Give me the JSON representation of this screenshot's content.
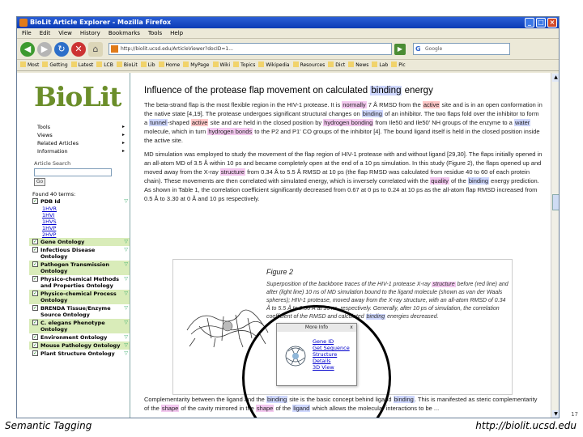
{
  "window": {
    "title": "BioLit Article Explorer - Mozilla Firefox"
  },
  "menubar": [
    "File",
    "Edit",
    "View",
    "History",
    "Bookmarks",
    "Tools",
    "Help"
  ],
  "navbar": {
    "url": "http://biolit.ucsd.edu/ArticleViewer?docID=1...",
    "search_placeholder": "Google"
  },
  "bookmarks": [
    "Most",
    "Getting",
    "Latest",
    "LCB",
    "BioLit",
    "Lib",
    "Home",
    "MyPage",
    "Wiki",
    "Topics",
    "Wikipedia",
    "Resources",
    "Dict",
    "News",
    "Lab",
    "Pic"
  ],
  "left_panel": {
    "logo": "BioLit",
    "menu": [
      {
        "label": "Tools",
        "arrow": "▸"
      },
      {
        "label": "Views",
        "arrow": "▸"
      },
      {
        "label": "Related Articles",
        "arrow": "▸"
      },
      {
        "label": "Information",
        "arrow": "▸"
      }
    ],
    "search_label": "Article Search",
    "go_label": "Go",
    "found_label": "Found 40 terms:",
    "categories": [
      {
        "name": "PDB Id",
        "links": [
          "1HVR",
          "1HVI",
          "1HVS",
          "1HVP",
          "2HVP"
        ]
      },
      {
        "name": "Gene Ontology",
        "links": []
      },
      {
        "name": "Infectious Disease Ontology",
        "links": []
      },
      {
        "name": "Pathogen Transmission Ontology",
        "links": []
      },
      {
        "name": "Physico-chemical Methods and Properties Ontology",
        "links": []
      },
      {
        "name": "Physico-chemical Process Ontology",
        "links": []
      },
      {
        "name": "BRENDA Tissue/Enzyme Source Ontology",
        "links": []
      },
      {
        "name": "C. elegans Phenotype Ontology",
        "links": []
      },
      {
        "name": "Environment Ontology",
        "links": []
      },
      {
        "name": "Mouse Pathology Ontology",
        "links": []
      },
      {
        "name": "Plant Structure Ontology",
        "links": []
      }
    ]
  },
  "main": {
    "title_pre": "Influence of the protease flap movement on calculated ",
    "title_hl": "binding",
    "title_post": " energy",
    "p1": {
      "a": "The beta-strand flap is the most flexible region in the HIV-1 protease. It is ",
      "h1": "normally",
      "b": " 7 Å RMSD from the ",
      "h2": "active",
      "c": " site and is in an open conformation in the native state [4,19]. The protease undergoes significant structural changes on ",
      "h3": "binding",
      "d": " of an inhibitor. The two flaps fold over the inhibitor to form a ",
      "h4": "tunnel",
      "e": "-shaped ",
      "h5": "active",
      "f": " site and are held in the closed position by ",
      "h6": "hydrogen bonding",
      "g": " from Ile50 and Ile50' NH groups of the enzyme to a ",
      "h7": "water",
      "h": " molecule, which in turn ",
      "h8": "hydrogen bonds",
      "i": " to the P2 and P1' CO groups of the inhibitor [4]. The bound ligand itself is held in the closed position inside the active site."
    },
    "p2": {
      "a": "MD simulation was employed to study the movement of the flap region of HIV-1 protease with and without ligand [29,30]. The flaps initially opened in an all-atom MD of 3.5 Å within 10 ps and became completely open at the end of a 10 ps simulation. In this study (Figure 2), the flaps opened up and moved away from the X-ray ",
      "h1": "structure",
      "b": " from 0.34 Å to 5.5 Å RMSD at 10 ps (the flap RMSD was calculated from residue 40 to 60 of each protein chain). These movements are then correlated with simulated energy, which is inversely correlated with the ",
      "h2": "quality",
      "c": " of the ",
      "h3": "binding",
      "d": " energy prediction. As shown in Table 1, the correlation coefficient significantly decreased from 0.67 at 0 ps to 0.24 at 10 ps as the all-atom flap RMSD increased from 0.5 Å to 3.30 at 0 Å and 10 ps respectively."
    },
    "figure": {
      "title": "Figure 2",
      "caption_a": "Superposition of the backbone traces of the HIV-1 protease X-ray ",
      "caption_h": "structure",
      "caption_b": " before (red line) and after (light line) 10 ns of MD simulation bound to the ligand molecule (shown as van der Waals spheres); HIV-1 protease, moved away from the X-ray structure, with an all-atom RMSD of 0.34 Å to 5.5 Å to 2.50 Å at 10 ns, respectively. Generally, after 10 ps of simulation, the correlation coefficient of the RMSD and calculated ",
      "caption_h2": "binding",
      "caption_c": " energies decreased."
    },
    "bottom": {
      "a": "Complementarity between the ligand and the ",
      "h1": "binding",
      "b": " site is the basic concept behind ligand ",
      "h2": "binding",
      "c": ". This is manifested as steric complementarity of the ",
      "h3": "shape",
      "d": " of the cavity mirrored in the ",
      "h4": "shape",
      "e": " of the ",
      "h5": "ligand",
      "f": " which allows the molecular interactions to be ..."
    }
  },
  "popup": {
    "title": "More Info",
    "close": "x",
    "links": [
      "Gene ID",
      "Get Sequence",
      "Structure",
      "Details",
      "3D View"
    ]
  },
  "footer": {
    "left": "Semantic Tagging",
    "right": "http://biolit.ucsd.edu",
    "slide_number": "17"
  },
  "colors": {
    "logo": "#6b8e2a",
    "category_alt_bg": "#d9ecb9",
    "highlight_blue": "#cfd8ff",
    "highlight_red": "#ffc8c8",
    "highlight_pink": "#f4c9f0"
  }
}
